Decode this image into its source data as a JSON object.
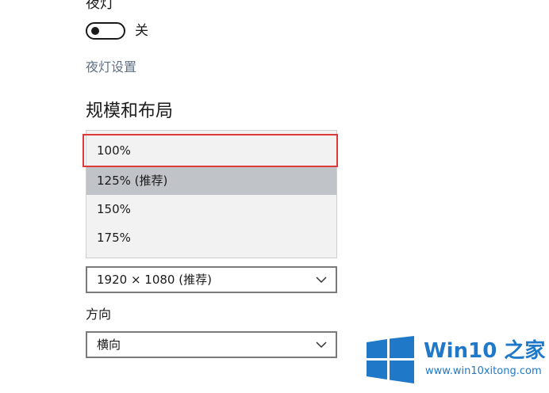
{
  "night_light": {
    "title": "夜灯",
    "toggle_state": "关",
    "settings_link": "夜灯设置"
  },
  "scale_layout": {
    "title": "规模和布局",
    "scale_options": [
      "100%",
      "125% (推荐)",
      "150%",
      "175%"
    ],
    "hovered_option": "125% (推荐)",
    "highlighted_option": "100%",
    "highlight_color": "#e0393b",
    "resolution": {
      "value": "1920 × 1080 (推荐)",
      "icon": "chevron-down-icon"
    },
    "orientation": {
      "label": "方向",
      "value": "横向",
      "icon": "chevron-down-icon"
    }
  },
  "watermark": {
    "brand": "Win10 之家",
    "url": "www.win10xitong.com",
    "icon": "windows-logo-icon",
    "color": "#1f78c8"
  },
  "colors": {
    "text": "#1a1a1a",
    "link": "#5f6f86",
    "dropdown_bg": "#f2f2f2",
    "hover_bg": "#c0c4c8"
  }
}
